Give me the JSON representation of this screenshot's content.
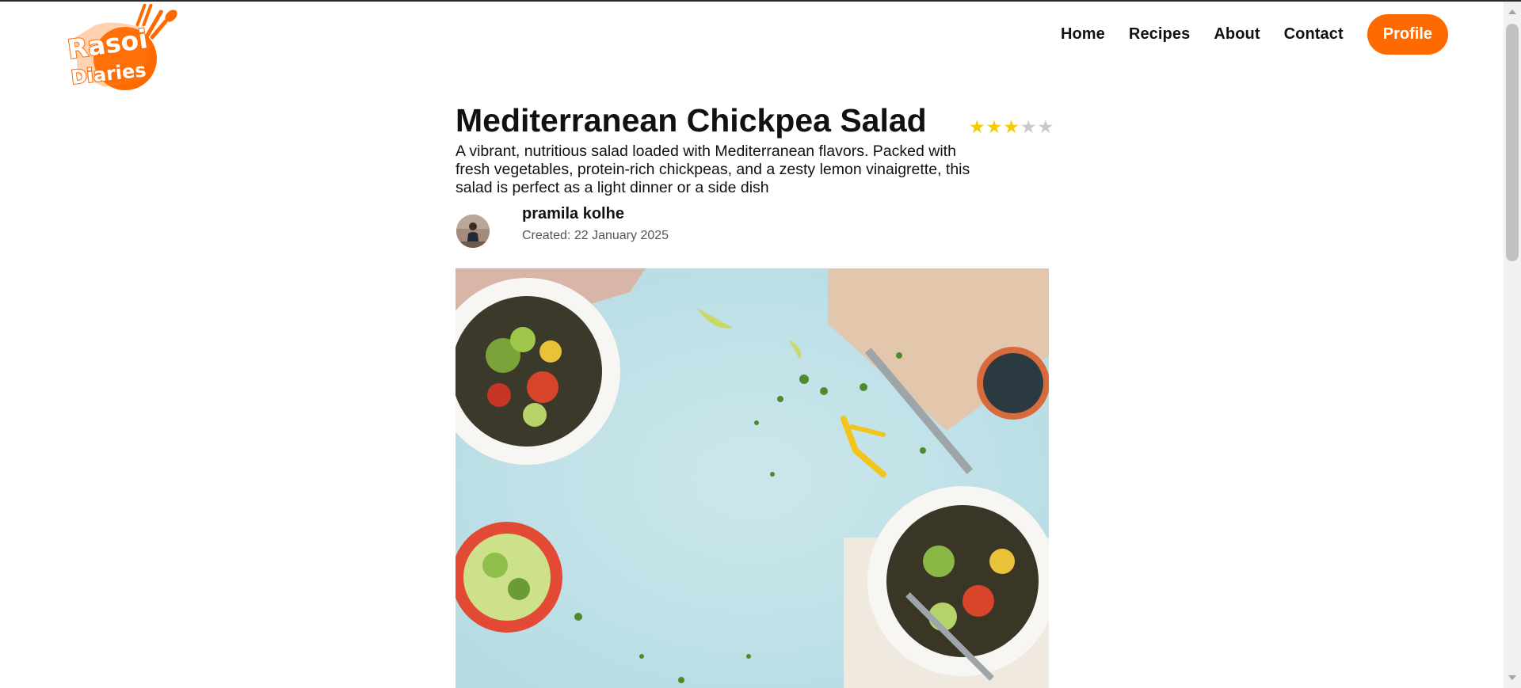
{
  "brand": {
    "logo_line1": "Rasoi",
    "logo_line2": "Diaries"
  },
  "nav": {
    "items": [
      {
        "label": "Home"
      },
      {
        "label": "Recipes"
      },
      {
        "label": "About"
      },
      {
        "label": "Contact"
      }
    ],
    "profile_label": "Profile"
  },
  "recipe": {
    "title": "Mediterranean Chickpea Salad",
    "rating": {
      "value": 3,
      "max": 5
    },
    "description": "A vibrant, nutritious salad loaded with Mediterranean flavors. Packed with fresh vegetables, protein-rich chickpeas, and a zesty lemon vinaigrette, this salad is perfect as a light dinner or a side dish",
    "author": "pramila kolhe",
    "created_prefix": "Created:",
    "created_date": "22 January 2025"
  },
  "colors": {
    "accent": "#ff6a00",
    "star_on": "#f5cc00",
    "star_off": "#c9c9c9",
    "hero_background": "#bfe0e6"
  }
}
